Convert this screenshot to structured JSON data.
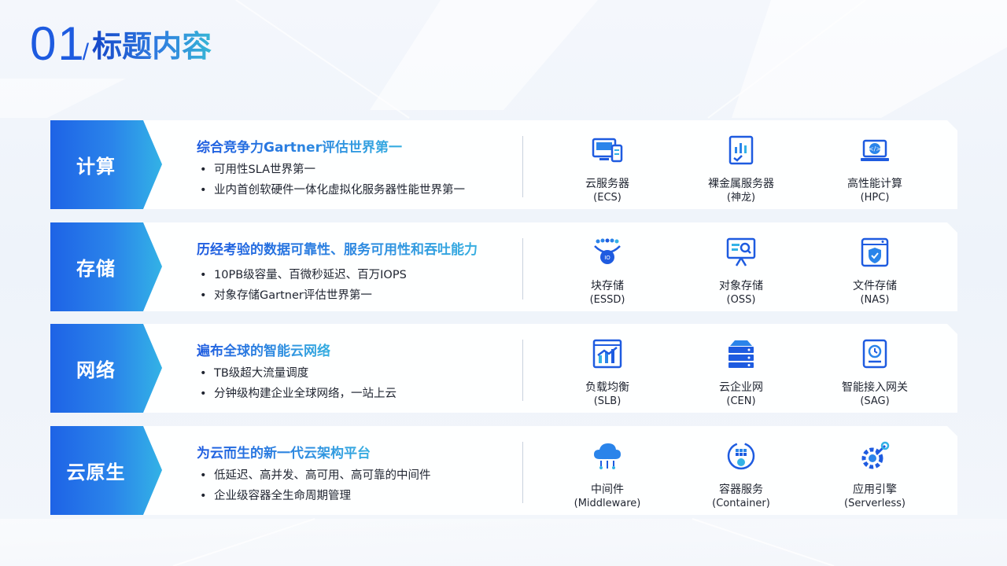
{
  "title": {
    "number": "01",
    "slash": "/",
    "text": "标题内容"
  },
  "rows": [
    {
      "tab": "计算",
      "headline": "综合竞争力Gartner评估世界第一",
      "bullets": [
        "可用性SLA世界第一",
        "业内首创软硬件一体化虚拟化服务器性能世界第一"
      ],
      "products": [
        {
          "icon": "server-monitor-icon",
          "name": "云服务器",
          "code": "(ECS)"
        },
        {
          "icon": "bare-metal-report-icon",
          "name": "裸金属服务器",
          "code": "(神龙)"
        },
        {
          "icon": "laptop-code-icon",
          "name": "高性能计算",
          "code": "(HPC)"
        }
      ]
    },
    {
      "tab": "存储",
      "headline": "历经考验的数据可靠性、服务可用性和吞吐能力",
      "bullets": [
        "10PB级容量、百微秒延迟、百万IOPS",
        "对象存储Gartner评估世界第一"
      ],
      "products": [
        {
          "icon": "block-storage-icon",
          "name": "块存储",
          "code": "(ESSD)"
        },
        {
          "icon": "object-storage-icon",
          "name": "对象存储",
          "code": "(OSS)"
        },
        {
          "icon": "file-storage-icon",
          "name": "文件存储",
          "code": "(NAS)"
        }
      ]
    },
    {
      "tab": "网络",
      "headline": "遍布全球的智能云网络",
      "bullets": [
        "TB级超大流量调度",
        "分钟级构建企业全球网络，一站上云"
      ],
      "products": [
        {
          "icon": "load-balancer-icon",
          "name": "负载均衡",
          "code": "(SLB)"
        },
        {
          "icon": "enterprise-network-icon",
          "name": "云企业网",
          "code": "(CEN)"
        },
        {
          "icon": "access-gateway-icon",
          "name": "智能接入网关",
          "code": "(SAG)"
        }
      ]
    },
    {
      "tab": "云原生",
      "headline": "为云而生的新一代云架构平台",
      "bullets": [
        "低延迟、高并发、高可用、高可靠的中间件",
        "企业级容器全生命周期管理"
      ],
      "products": [
        {
          "icon": "cloud-middleware-icon",
          "name": "中间件",
          "code": "(Middleware)"
        },
        {
          "icon": "container-service-icon",
          "name": "容器服务",
          "code": "(Container)"
        },
        {
          "icon": "engine-gear-icon",
          "name": "应用引擎",
          "code": "(Serverless)"
        }
      ]
    }
  ],
  "colors": {
    "primary": "#1e5be0",
    "accent": "#33b2e6",
    "text": "#1f2430"
  }
}
